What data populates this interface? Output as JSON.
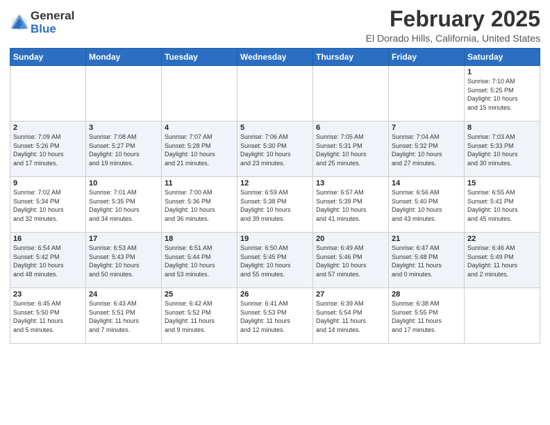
{
  "logo": {
    "general": "General",
    "blue": "Blue"
  },
  "header": {
    "month": "February 2025",
    "location": "El Dorado Hills, California, United States"
  },
  "weekdays": [
    "Sunday",
    "Monday",
    "Tuesday",
    "Wednesday",
    "Thursday",
    "Friday",
    "Saturday"
  ],
  "weeks": [
    [
      {
        "day": "",
        "info": ""
      },
      {
        "day": "",
        "info": ""
      },
      {
        "day": "",
        "info": ""
      },
      {
        "day": "",
        "info": ""
      },
      {
        "day": "",
        "info": ""
      },
      {
        "day": "",
        "info": ""
      },
      {
        "day": "1",
        "info": "Sunrise: 7:10 AM\nSunset: 5:25 PM\nDaylight: 10 hours\nand 15 minutes."
      }
    ],
    [
      {
        "day": "2",
        "info": "Sunrise: 7:09 AM\nSunset: 5:26 PM\nDaylight: 10 hours\nand 17 minutes."
      },
      {
        "day": "3",
        "info": "Sunrise: 7:08 AM\nSunset: 5:27 PM\nDaylight: 10 hours\nand 19 minutes."
      },
      {
        "day": "4",
        "info": "Sunrise: 7:07 AM\nSunset: 5:28 PM\nDaylight: 10 hours\nand 21 minutes."
      },
      {
        "day": "5",
        "info": "Sunrise: 7:06 AM\nSunset: 5:30 PM\nDaylight: 10 hours\nand 23 minutes."
      },
      {
        "day": "6",
        "info": "Sunrise: 7:05 AM\nSunset: 5:31 PM\nDaylight: 10 hours\nand 25 minutes."
      },
      {
        "day": "7",
        "info": "Sunrise: 7:04 AM\nSunset: 5:32 PM\nDaylight: 10 hours\nand 27 minutes."
      },
      {
        "day": "8",
        "info": "Sunrise: 7:03 AM\nSunset: 5:33 PM\nDaylight: 10 hours\nand 30 minutes."
      }
    ],
    [
      {
        "day": "9",
        "info": "Sunrise: 7:02 AM\nSunset: 5:34 PM\nDaylight: 10 hours\nand 32 minutes."
      },
      {
        "day": "10",
        "info": "Sunrise: 7:01 AM\nSunset: 5:35 PM\nDaylight: 10 hours\nand 34 minutes."
      },
      {
        "day": "11",
        "info": "Sunrise: 7:00 AM\nSunset: 5:36 PM\nDaylight: 10 hours\nand 36 minutes."
      },
      {
        "day": "12",
        "info": "Sunrise: 6:59 AM\nSunset: 5:38 PM\nDaylight: 10 hours\nand 39 minutes."
      },
      {
        "day": "13",
        "info": "Sunrise: 6:57 AM\nSunset: 5:39 PM\nDaylight: 10 hours\nand 41 minutes."
      },
      {
        "day": "14",
        "info": "Sunrise: 6:56 AM\nSunset: 5:40 PM\nDaylight: 10 hours\nand 43 minutes."
      },
      {
        "day": "15",
        "info": "Sunrise: 6:55 AM\nSunset: 5:41 PM\nDaylight: 10 hours\nand 45 minutes."
      }
    ],
    [
      {
        "day": "16",
        "info": "Sunrise: 6:54 AM\nSunset: 5:42 PM\nDaylight: 10 hours\nand 48 minutes."
      },
      {
        "day": "17",
        "info": "Sunrise: 6:53 AM\nSunset: 5:43 PM\nDaylight: 10 hours\nand 50 minutes."
      },
      {
        "day": "18",
        "info": "Sunrise: 6:51 AM\nSunset: 5:44 PM\nDaylight: 10 hours\nand 53 minutes."
      },
      {
        "day": "19",
        "info": "Sunrise: 6:50 AM\nSunset: 5:45 PM\nDaylight: 10 hours\nand 55 minutes."
      },
      {
        "day": "20",
        "info": "Sunrise: 6:49 AM\nSunset: 5:46 PM\nDaylight: 10 hours\nand 57 minutes."
      },
      {
        "day": "21",
        "info": "Sunrise: 6:47 AM\nSunset: 5:48 PM\nDaylight: 11 hours\nand 0 minutes."
      },
      {
        "day": "22",
        "info": "Sunrise: 6:46 AM\nSunset: 5:49 PM\nDaylight: 11 hours\nand 2 minutes."
      }
    ],
    [
      {
        "day": "23",
        "info": "Sunrise: 6:45 AM\nSunset: 5:50 PM\nDaylight: 11 hours\nand 5 minutes."
      },
      {
        "day": "24",
        "info": "Sunrise: 6:43 AM\nSunset: 5:51 PM\nDaylight: 11 hours\nand 7 minutes."
      },
      {
        "day": "25",
        "info": "Sunrise: 6:42 AM\nSunset: 5:52 PM\nDaylight: 11 hours\nand 9 minutes."
      },
      {
        "day": "26",
        "info": "Sunrise: 6:41 AM\nSunset: 5:53 PM\nDaylight: 11 hours\nand 12 minutes."
      },
      {
        "day": "27",
        "info": "Sunrise: 6:39 AM\nSunset: 5:54 PM\nDaylight: 11 hours\nand 14 minutes."
      },
      {
        "day": "28",
        "info": "Sunrise: 6:38 AM\nSunset: 5:55 PM\nDaylight: 11 hours\nand 17 minutes."
      },
      {
        "day": "",
        "info": ""
      }
    ]
  ]
}
